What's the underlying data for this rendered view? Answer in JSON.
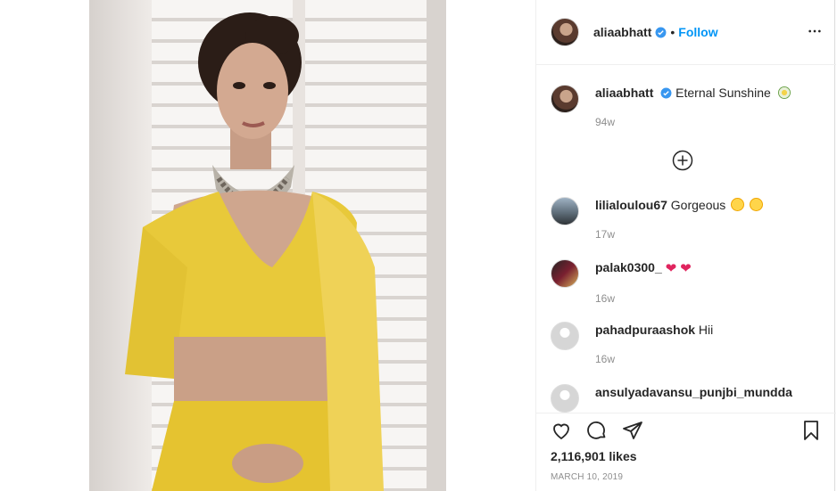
{
  "post": {
    "owner": "aliaabhatt",
    "follow_label": "Follow",
    "separator": "•",
    "caption_user": "aliaabhatt",
    "caption_text": "Eternal Sunshine",
    "caption_time": "94w",
    "likes": "2,116,901 likes",
    "date": "MARCH 10, 2019"
  },
  "comments": [
    {
      "user": "lilialoulou67",
      "text": "Gorgeous",
      "time": "17w"
    },
    {
      "user": "palak0300_",
      "text": "",
      "time": "16w"
    },
    {
      "user": "pahadpuraashok",
      "text": "Hii",
      "time": "16w"
    },
    {
      "user": "ansulyadavansu_punjbi_mundda",
      "text": "",
      "time": ""
    }
  ],
  "icons": {
    "like": "heart-outline-icon",
    "comment": "comment-bubble-icon",
    "share": "paper-plane-icon",
    "save": "bookmark-icon",
    "more": "more-horizontal-icon",
    "load_more": "plus-circle-icon",
    "verified": "verified-badge-icon"
  },
  "colors": {
    "link_blue": "#0095f6",
    "verified_blue": "#3897f0",
    "heart_red": "#e0245e",
    "outfit_yellow": "#e8c93a"
  }
}
